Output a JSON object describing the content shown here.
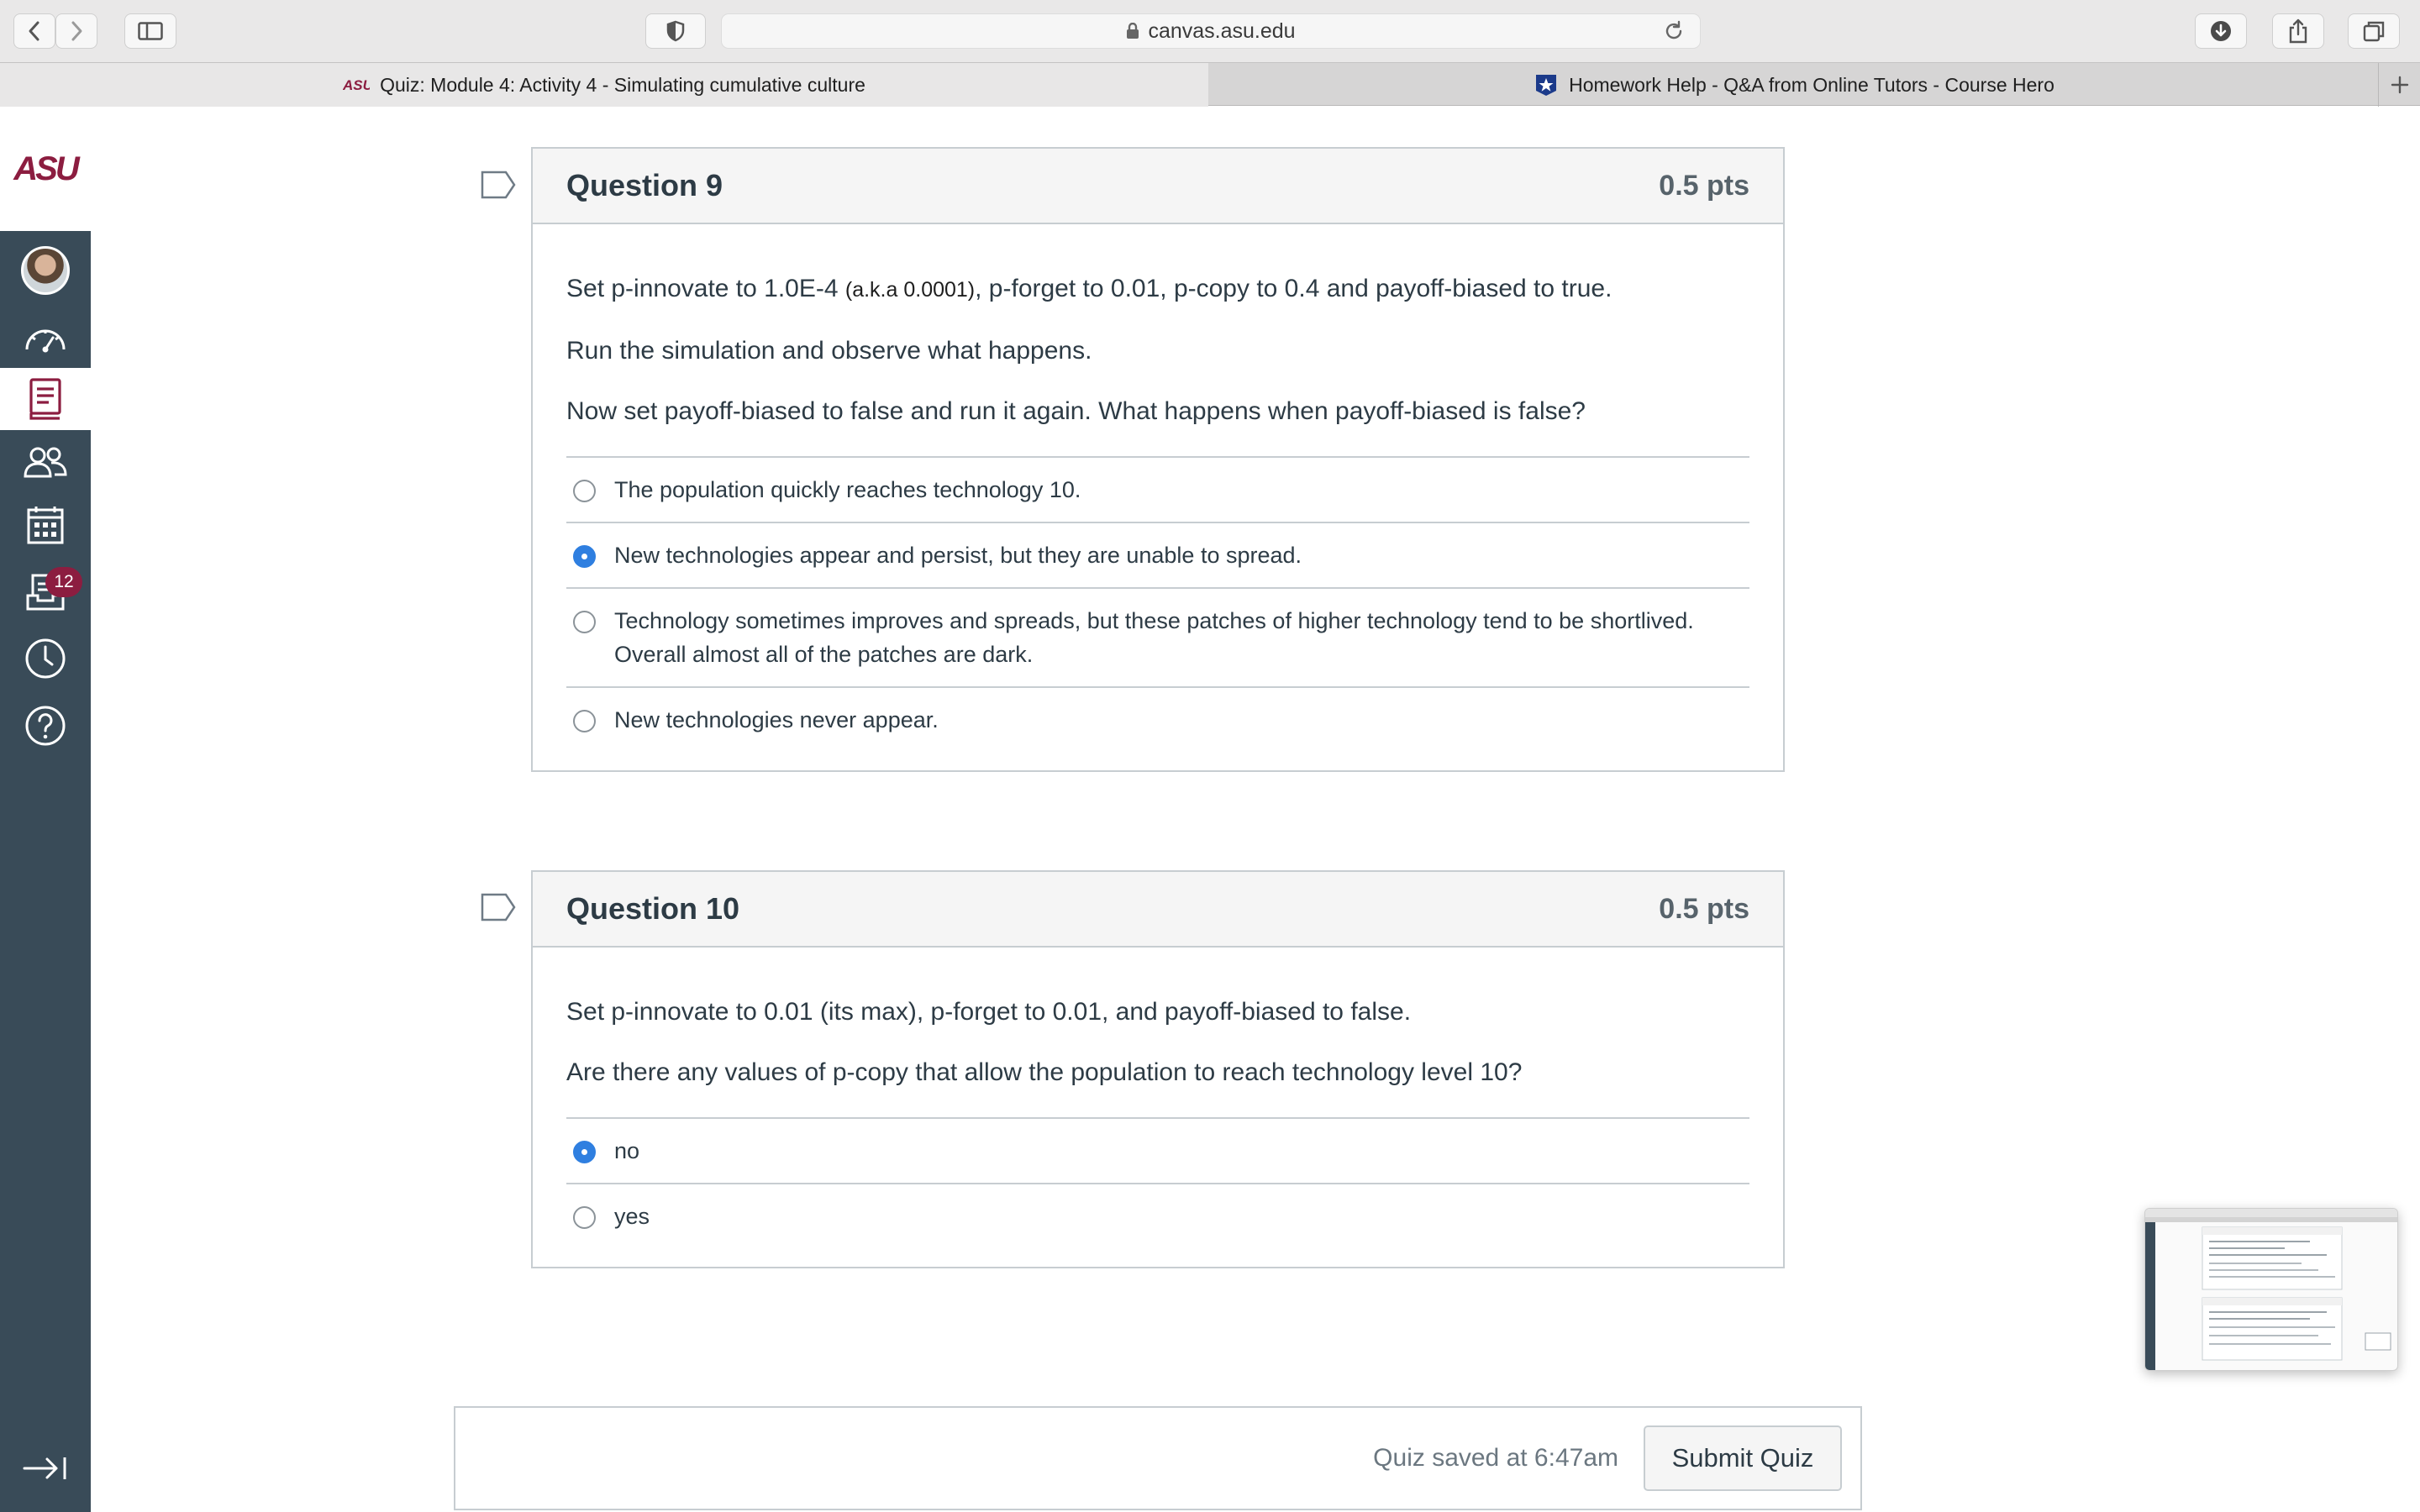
{
  "browser": {
    "url": "canvas.asu.edu",
    "tabs": [
      {
        "label": "Quiz: Module 4: Activity 4 - Simulating cumulative culture",
        "active": true
      },
      {
        "label": "Homework Help - Q&A from Online Tutors - Course Hero",
        "active": false
      }
    ]
  },
  "sidebar": {
    "logo": "ASU",
    "items": [
      {
        "name": "account",
        "icon": "avatar-icon"
      },
      {
        "name": "dashboard",
        "icon": "speedometer-icon"
      },
      {
        "name": "courses",
        "icon": "book-icon",
        "active": true
      },
      {
        "name": "groups",
        "icon": "people-icon"
      },
      {
        "name": "calendar",
        "icon": "calendar-icon"
      },
      {
        "name": "inbox",
        "icon": "inbox-icon",
        "badge": "12"
      },
      {
        "name": "history",
        "icon": "clock-icon"
      },
      {
        "name": "help",
        "icon": "help-icon"
      }
    ],
    "collapse_icon": "collapse-arrow-icon"
  },
  "questions": [
    {
      "title": "Question 9",
      "points": "0.5 pts",
      "text_line1_a": "Set p-innovate to 1.0E-4 ",
      "text_line1_small": "(a.k.a 0.0001)",
      "text_line1_b": ", p-forget to 0.01, p-copy to 0.4 and payoff-biased to true.",
      "text_line2": "Run the simulation and observe what happens.",
      "text_line3": "Now set payoff-biased to false and run it again. What happens when payoff-biased is false?",
      "answers": [
        {
          "label": "The population quickly reaches technology 10.",
          "selected": false
        },
        {
          "label": "New technologies appear and persist, but they are unable to spread.",
          "selected": true
        },
        {
          "label": "Technology sometimes improves and spreads, but these patches of higher technology tend to be shortlived. Overall almost all of the patches are dark.",
          "selected": false
        },
        {
          "label": "New technologies never appear.",
          "selected": false
        }
      ]
    },
    {
      "title": "Question 10",
      "points": "0.5 pts",
      "text_line1": "Set p-innovate to 0.01 (its max), p-forget to 0.01, and payoff-biased to false.",
      "text_line2": "Are there any values of p-copy that allow the population to reach technology level 10?",
      "answers": [
        {
          "label": "no",
          "selected": true
        },
        {
          "label": "yes",
          "selected": false
        }
      ]
    }
  ],
  "footer": {
    "saved_text": "Quiz saved at 6:47am",
    "submit_label": "Submit Quiz"
  },
  "colors": {
    "brand": "#8c1d40",
    "sidebar_bg": "#394b58",
    "radio_selected": "#2f7fe0"
  }
}
